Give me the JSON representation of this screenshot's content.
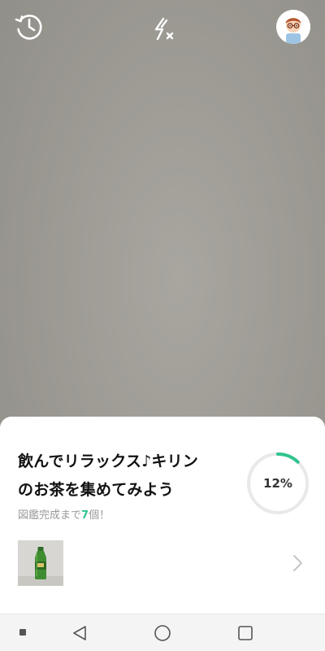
{
  "camera": {
    "view": "camera-preview"
  },
  "top_bar": {
    "history_icon": "history-clock-icon",
    "flash_icon": "flash-off-icon",
    "avatar_icon": "user-avatar-icon"
  },
  "card": {
    "title_line1": "飲んでリラックス♪キリン",
    "title_line2": "のお茶を集めてみよう",
    "remaining_prefix": "図鑑完成まで",
    "remaining_count": "7",
    "remaining_suffix": "個！",
    "progress_label": "12%",
    "progress_value": 0.12,
    "thumbnail_icon": "green-tea-bottle-thumbnail",
    "chevron_icon": "chevron-right-icon"
  },
  "nav_bar": {
    "extra_icon": "square-dot-icon",
    "back_icon": "back-triangle-icon",
    "home_icon": "home-circle-icon",
    "recents_icon": "recents-square-icon"
  },
  "colors": {
    "accent": "#2fc48d",
    "ring_track": "#e9e9e9",
    "sheet_bg": "#ffffff",
    "camera_bg": "#9d9b94"
  }
}
